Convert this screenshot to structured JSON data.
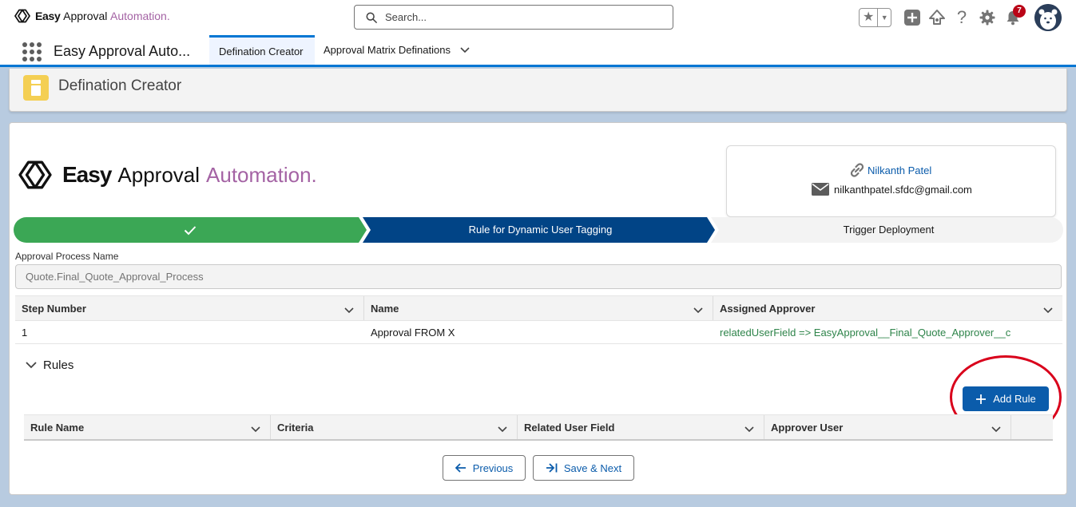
{
  "global_header": {
    "logo": {
      "easy": "Easy",
      "approval": "Approval",
      "automation": "Automation."
    },
    "search": {
      "placeholder": "Search..."
    },
    "notifications_count": "7"
  },
  "nav": {
    "app_name": "Easy Approval Auto...",
    "tabs": [
      {
        "label": "Defination Creator",
        "active": true
      },
      {
        "label": "Approval Matrix Definations",
        "active": false
      }
    ]
  },
  "page_header": {
    "title": "Defination Creator"
  },
  "brand": {
    "easy": "Easy",
    "approval": "Approval",
    "automation": "Automation."
  },
  "profile": {
    "name": "Nilkanth Patel",
    "email": "nilkanthpatel.sfdc@gmail.com"
  },
  "path": {
    "steps": [
      {
        "label": "",
        "state": "complete"
      },
      {
        "label": "Rule for Dynamic User Tagging",
        "state": "current"
      },
      {
        "label": "Trigger Deployment",
        "state": "incomplete"
      }
    ]
  },
  "approval_process": {
    "label": "Approval Process Name",
    "value": "Quote.Final_Quote_Approval_Process"
  },
  "steps_table": {
    "columns": [
      "Step Number",
      "Name",
      "Assigned Approver"
    ],
    "rows": [
      {
        "step_number": "1",
        "name": "Approval FROM X",
        "assigned_approver": "relatedUserField => EasyApproval__Final_Quote_Approver__c"
      }
    ]
  },
  "rules": {
    "section_label": "Rules",
    "add_rule_label": "Add Rule",
    "columns": [
      "Rule Name",
      "Criteria",
      "Related User Field",
      "Approver User"
    ]
  },
  "footer": {
    "previous_label": "Previous",
    "save_next_label": "Save & Next"
  },
  "colors": {
    "brand_blue": "#0b5cab",
    "path_complete": "#3ba755",
    "path_current": "#014486",
    "accent_purple": "#a463a4",
    "annotation_red": "#d9001b"
  }
}
